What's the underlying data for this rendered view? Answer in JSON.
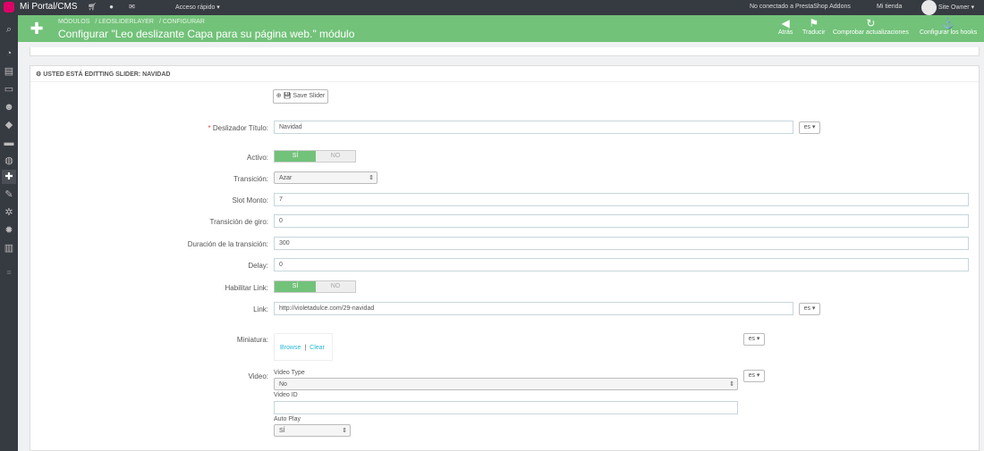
{
  "topbar": {
    "brand": "Mi Portal/CMS",
    "quick_access": "Acceso rápido ▾",
    "addons": "No conectado a PrestaShop Addons",
    "shop": "Mi tienda",
    "owner": "Site Owner ▾",
    "icons": [
      "cart-icon",
      "user-icon",
      "envelope-icon"
    ]
  },
  "header": {
    "breadcrumb": [
      "MÓDULOS",
      "/ LEOSLIDERLAYER",
      "/ CONFIGURAR"
    ],
    "title": "Configurar \"Leo deslizante Capa para su página web.\" módulo",
    "toolbar": {
      "back": "Atrás",
      "translate": "Traducir",
      "check_updates": "Comprobar actualizaciones",
      "hooks": "Configurar los hooks"
    }
  },
  "panel": {
    "heading": "USTED ESTÁ EDITTING SLIDER: NAVIDAD",
    "save_label": "Save Slider",
    "fields": {
      "title_label": "Deslizador Título:",
      "title_value": "Navidad",
      "lang": "es ▾",
      "active_label": "Activo:",
      "yes": "SÍ",
      "no": "NO",
      "transition_label": "Transición:",
      "transition_value": "Azar",
      "slot_label": "Slot Monto:",
      "slot_value": "7",
      "rotation_label": "Transición de giro:",
      "rotation_value": "0",
      "duration_label": "Duración de la transición:",
      "duration_value": "300",
      "delay_label": "Delay:",
      "delay_value": "0",
      "link_enable_label": "Habilitar Link:",
      "link_label": "Link:",
      "link_value": "http://violetadulce.com/29-navidad",
      "thumb_label": "Miniatura:",
      "browse": "Browse",
      "sep": "|",
      "clear": "Clear",
      "video_label": "Video:",
      "video_type_label": "Video Type",
      "video_type_value": "No",
      "video_id_label": "Video ID",
      "video_id_value": "",
      "autoplay_label": "Auto Play",
      "autoplay_value": "SÍ"
    }
  },
  "colors": {
    "header_green": "#72c279",
    "topbar_dark": "#363a41",
    "link_blue": "#25b9d7"
  }
}
